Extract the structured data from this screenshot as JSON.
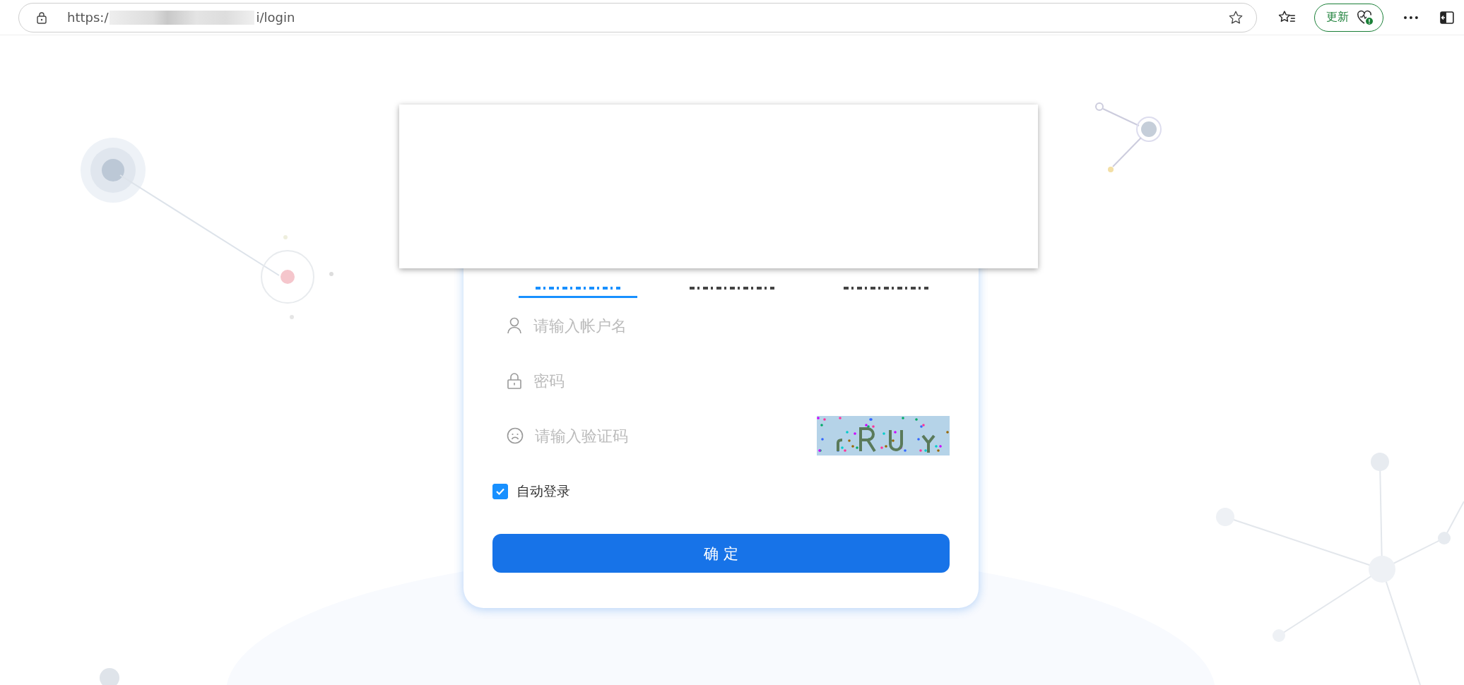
{
  "browser": {
    "url_start": "https:/",
    "url_end": "i/login",
    "update_button": "更新"
  },
  "login": {
    "tabs": [
      {
        "selected": true
      },
      {
        "selected": false
      },
      {
        "selected": false
      }
    ],
    "fields": [
      {
        "kind": "user",
        "placeholder": "请输入帐户名"
      },
      {
        "kind": "password",
        "placeholder": "密码"
      },
      {
        "kind": "captcha",
        "placeholder": "请输入验证码"
      }
    ],
    "auto_login": {
      "label": "自动登录",
      "checked": true
    },
    "submit": "确 定"
  }
}
